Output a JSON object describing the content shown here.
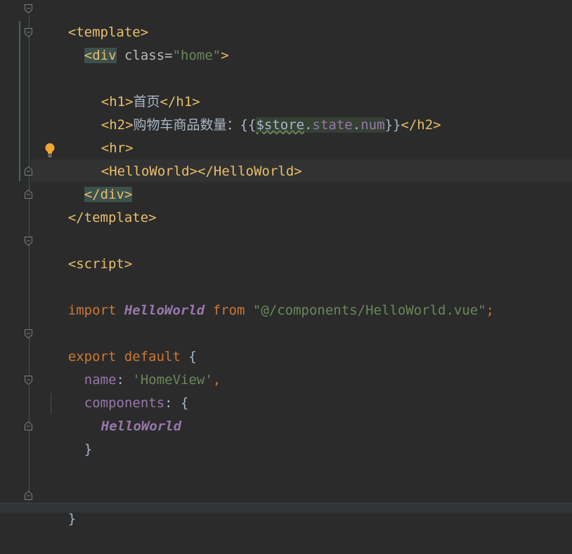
{
  "code": {
    "l1": {
      "open": "<template>"
    },
    "l2": {
      "tag_open": "<div",
      "attr": " class=",
      "val": "\"home\"",
      "close": ">"
    },
    "l4": {
      "a": "<h1>",
      "text": "首页",
      "b": "</h1>"
    },
    "l5": {
      "a": "<h2>",
      "text": "购物车商品数量：",
      "brace_open": "{{",
      "store": "$store",
      "dot1": ".",
      "state": "state",
      "dot2": ".",
      "num": "num",
      "brace_close": "}}",
      "b": "</h2>"
    },
    "l6": {
      "a": "<hr>"
    },
    "l7": {
      "a": "<HelloWorld></HelloWorld>"
    },
    "l8": {
      "a": "</div>"
    },
    "l9": {
      "a": "</template>"
    },
    "l11": {
      "a": "<script>"
    },
    "l13": {
      "kw1": "import",
      "cls": "HelloWorld",
      "kw2": "from",
      "str": "\"@/components/HelloWorld.vue\"",
      "semi": ";"
    },
    "l15": {
      "kw": "export default",
      "brace": " {"
    },
    "l16": {
      "prop": "name",
      "colon": ": ",
      "str": "'HomeView'",
      "comma": ","
    },
    "l17": {
      "prop": "components",
      "colon": ": {"
    },
    "l18": {
      "cls": "HelloWorld"
    },
    "l19": {
      "brace": "}"
    },
    "l22": {
      "brace": "}"
    }
  },
  "icons": {
    "fold": "fold-marker-icon",
    "bulb": "lightbulb-intention-icon"
  },
  "colors": {
    "background": "#2b2b2b",
    "tag": "#e8bf6a",
    "string": "#6a8759",
    "keyword": "#cc7832",
    "property": "#9876aa"
  }
}
